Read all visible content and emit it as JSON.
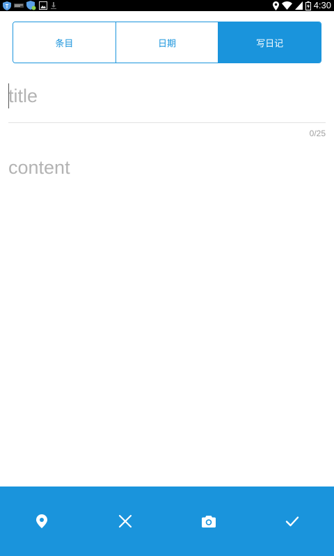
{
  "status_bar": {
    "time": "4:30",
    "left_icons": [
      "shield-icon",
      "app-icon",
      "shield-badge-icon",
      "image-icon",
      "download-icon"
    ],
    "right_icons": [
      "location-icon",
      "wifi-icon",
      "signal-icon",
      "battery-icon"
    ]
  },
  "tabs": [
    {
      "label": "条目",
      "active": false
    },
    {
      "label": "日期",
      "active": false
    },
    {
      "label": "写日记",
      "active": true
    }
  ],
  "editor": {
    "title_placeholder": "title",
    "title_value": "",
    "counter": "0/25",
    "content_placeholder": "content",
    "content_value": ""
  },
  "toolbar": {
    "items": [
      "location-pin-icon",
      "close-icon",
      "camera-icon",
      "check-icon"
    ]
  },
  "colors": {
    "accent": "#1a94dc",
    "placeholder": "#b3b3b3",
    "divider": "#e2e2e2"
  }
}
